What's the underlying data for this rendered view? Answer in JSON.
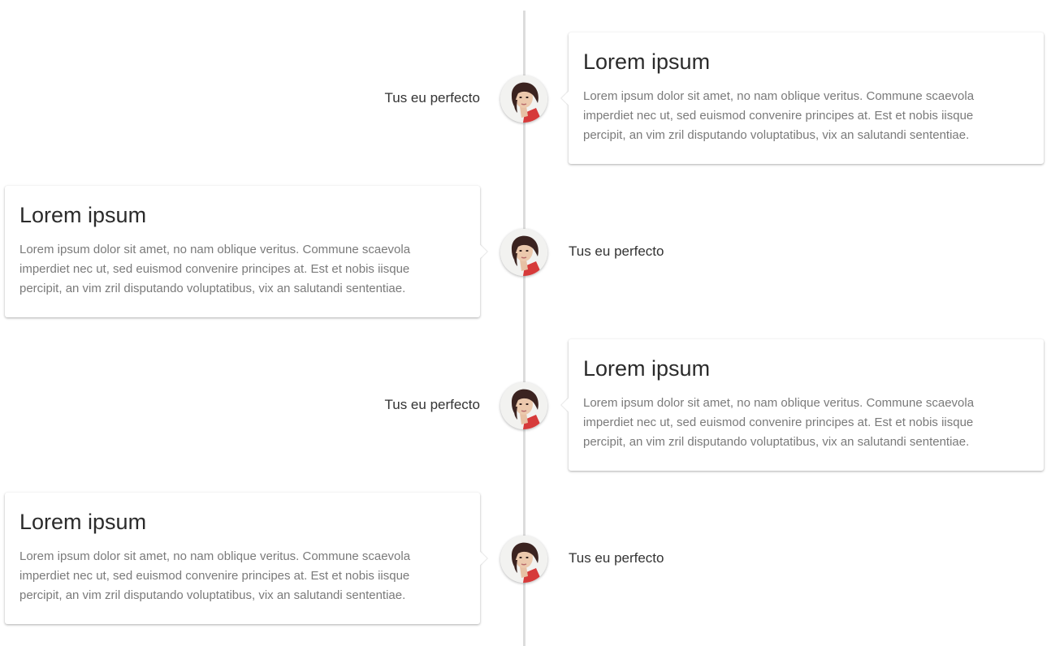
{
  "timeline": {
    "items": [
      {
        "side": "right",
        "title": "Lorem ipsum",
        "text_lines": [
          "Lorem ipsum dolor sit amet, no nam oblique veritus. Commune scaevola",
          "imperdiet nec ut, sed euismod convenire principes at. Est et nobis iisque",
          "percipit, an vim zril disputando voluptatibus, vix an salutandi sententiae."
        ],
        "label": "Tus eu perfecto",
        "avatar_icon": "person-portrait-avatar"
      },
      {
        "side": "left",
        "title": "Lorem ipsum",
        "text_lines": [
          "Lorem ipsum dolor sit amet, no nam oblique veritus. Commune scaevola",
          "imperdiet nec ut, sed euismod convenire principes at. Est et nobis iisque",
          "percipit, an vim zril disputando voluptatibus, vix an salutandi sententiae."
        ],
        "label": "Tus eu perfecto",
        "avatar_icon": "person-portrait-avatar"
      },
      {
        "side": "right",
        "title": "Lorem ipsum",
        "text_lines": [
          "Lorem ipsum dolor sit amet, no nam oblique veritus. Commune scaevola",
          "imperdiet nec ut, sed euismod convenire principes at. Est et nobis iisque",
          "percipit, an vim zril disputando voluptatibus, vix an salutandi sententiae."
        ],
        "label": "Tus eu perfecto",
        "avatar_icon": "person-portrait-avatar"
      },
      {
        "side": "left",
        "title": "Lorem ipsum",
        "text_lines": [
          "Lorem ipsum dolor sit amet, no nam oblique veritus. Commune scaevola",
          "imperdiet nec ut, sed euismod convenire principes at. Est et nobis iisque",
          "percipit, an vim zril disputando voluptatibus, vix an salutandi sententiae."
        ],
        "label": "Tus eu perfecto",
        "avatar_icon": "person-portrait-avatar"
      }
    ]
  },
  "colors": {
    "axis": "#dcdcdc",
    "title": "#2b2b2b",
    "body_text": "#7a7a7a",
    "label": "#333333"
  }
}
